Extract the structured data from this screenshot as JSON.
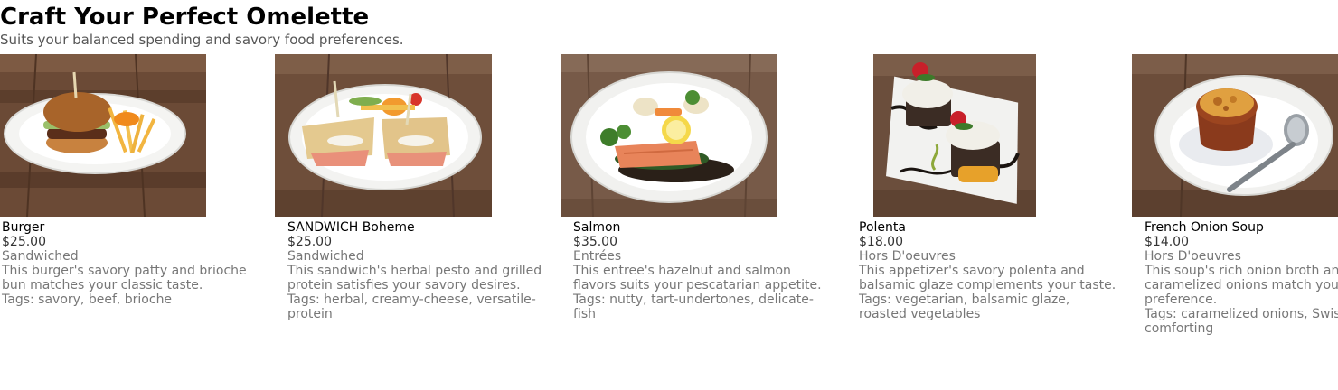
{
  "header": {
    "title": "Craft Your Perfect Omelette",
    "subtitle": "Suits your balanced spending and savory food preferences."
  },
  "items": [
    {
      "name": "Burger",
      "price": "$25.00",
      "category": "Sandwiched",
      "description": "This burger's savory patty and brioche bun matches your classic taste.",
      "tags": "Tags: savory, beef, brioche",
      "image_icon": "burger-photo"
    },
    {
      "name": "SANDWICH Boheme",
      "price": "$25.00",
      "category": "Sandwiched",
      "description": "This sandwich's herbal pesto and grilled protein satisfies your savory desires.",
      "tags": "Tags: herbal, creamy-cheese, versatile-protein",
      "image_icon": "sandwich-photo"
    },
    {
      "name": "Salmon",
      "price": "$35.00",
      "category": "Entrées",
      "description": "This entree's hazelnut and salmon flavors suits your pescatarian appetite.",
      "tags": "Tags: nutty, tart-undertones, delicate-fish",
      "image_icon": "salmon-photo"
    },
    {
      "name": "Polenta",
      "price": "$18.00",
      "category": "Hors D'oeuvres",
      "description": "This appetizer's savory polenta and balsamic glaze complements your taste.",
      "tags": "Tags: vegetarian, balsamic glaze, roasted vegetables",
      "image_icon": "polenta-photo"
    },
    {
      "name": "French Onion Soup",
      "price": "$14.00",
      "category": "Hors D'oeuvres",
      "description": "This soup's rich onion broth and caramelized onions match your preference.",
      "tags": "Tags: caramelized onions, Swiss, comforting",
      "image_icon": "soup-photo"
    }
  ]
}
